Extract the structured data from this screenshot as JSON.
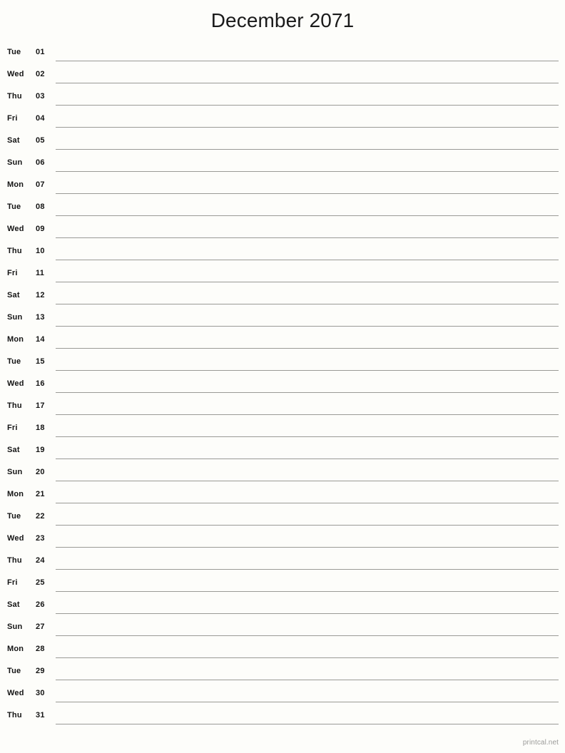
{
  "header": {
    "title": "December 2071"
  },
  "footer": {
    "credit": "printcal.net"
  },
  "colors": {
    "background": "#fdfdfa",
    "text": "#141414",
    "title": "#1a1a1a",
    "rule": "#9a9a96",
    "footer": "#9b9b99"
  },
  "calendar": {
    "month": "December",
    "year": "2071",
    "days": [
      {
        "weekday": "Tue",
        "number": "01"
      },
      {
        "weekday": "Wed",
        "number": "02"
      },
      {
        "weekday": "Thu",
        "number": "03"
      },
      {
        "weekday": "Fri",
        "number": "04"
      },
      {
        "weekday": "Sat",
        "number": "05"
      },
      {
        "weekday": "Sun",
        "number": "06"
      },
      {
        "weekday": "Mon",
        "number": "07"
      },
      {
        "weekday": "Tue",
        "number": "08"
      },
      {
        "weekday": "Wed",
        "number": "09"
      },
      {
        "weekday": "Thu",
        "number": "10"
      },
      {
        "weekday": "Fri",
        "number": "11"
      },
      {
        "weekday": "Sat",
        "number": "12"
      },
      {
        "weekday": "Sun",
        "number": "13"
      },
      {
        "weekday": "Mon",
        "number": "14"
      },
      {
        "weekday": "Tue",
        "number": "15"
      },
      {
        "weekday": "Wed",
        "number": "16"
      },
      {
        "weekday": "Thu",
        "number": "17"
      },
      {
        "weekday": "Fri",
        "number": "18"
      },
      {
        "weekday": "Sat",
        "number": "19"
      },
      {
        "weekday": "Sun",
        "number": "20"
      },
      {
        "weekday": "Mon",
        "number": "21"
      },
      {
        "weekday": "Tue",
        "number": "22"
      },
      {
        "weekday": "Wed",
        "number": "23"
      },
      {
        "weekday": "Thu",
        "number": "24"
      },
      {
        "weekday": "Fri",
        "number": "25"
      },
      {
        "weekday": "Sat",
        "number": "26"
      },
      {
        "weekday": "Sun",
        "number": "27"
      },
      {
        "weekday": "Mon",
        "number": "28"
      },
      {
        "weekday": "Tue",
        "number": "29"
      },
      {
        "weekday": "Wed",
        "number": "30"
      },
      {
        "weekday": "Thu",
        "number": "31"
      }
    ]
  }
}
